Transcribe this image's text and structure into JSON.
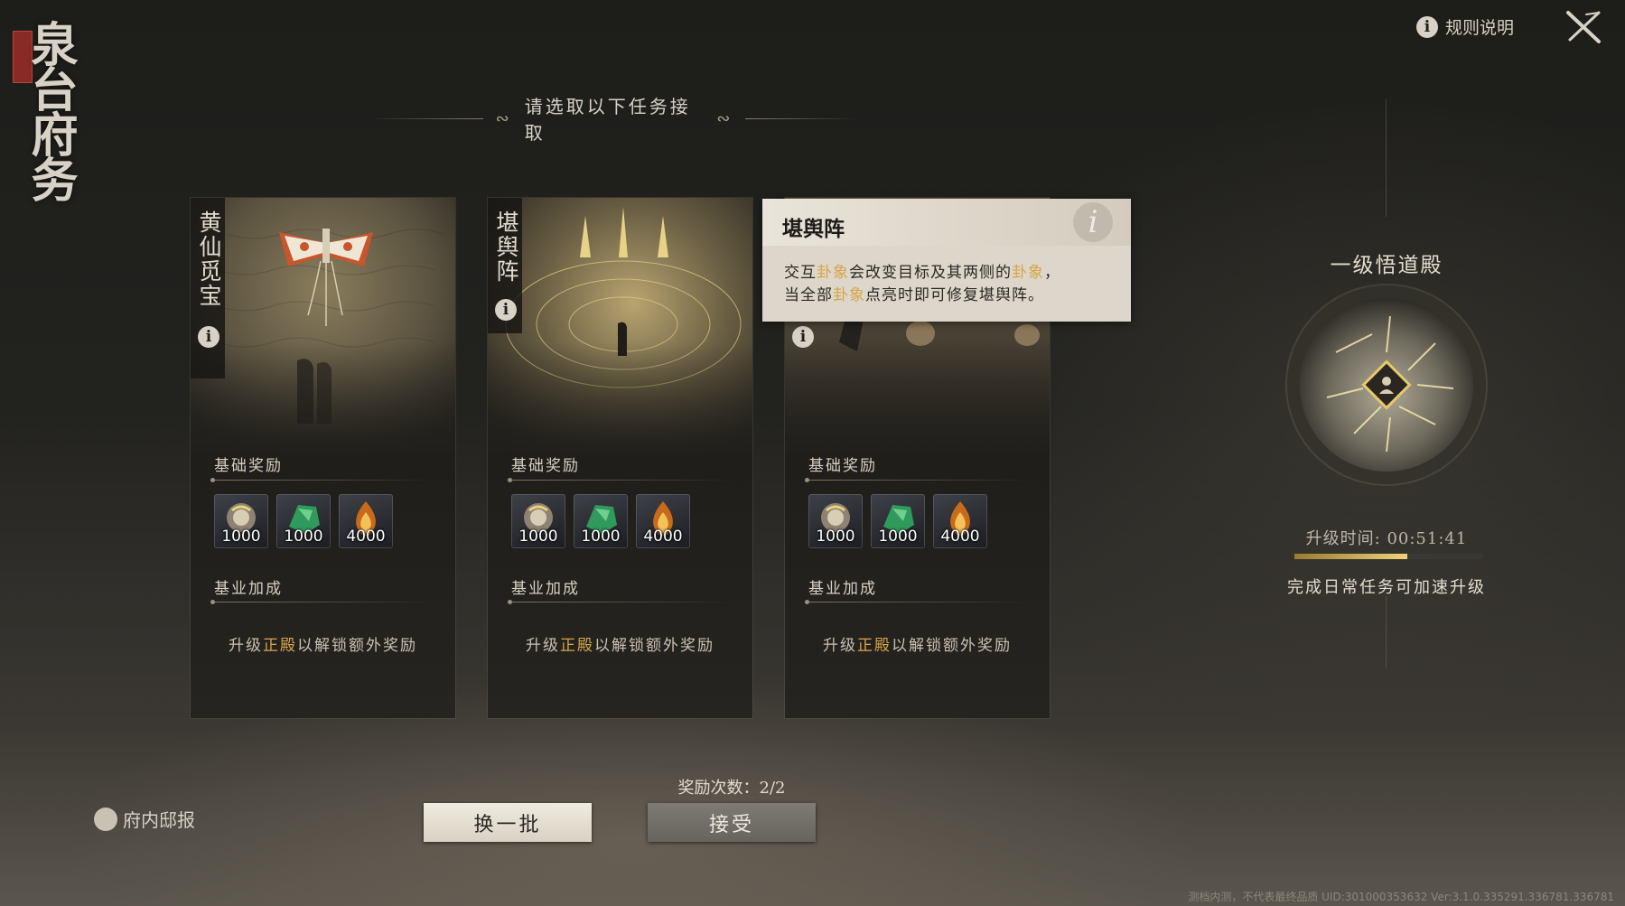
{
  "app": {
    "title": "泉台府务"
  },
  "header": {
    "rules_label": "规则说明",
    "info_glyph": "i",
    "close_icon": "close-x-icon"
  },
  "prompt": "请选取以下任务接取",
  "cards": [
    {
      "title": "黄仙觅宝",
      "base_reward_label": "基础奖励",
      "rewards": [
        "1000",
        "1000",
        "4000"
      ],
      "bonus_label": "基业加成",
      "unlock_pre": "升级",
      "unlock_hl": "正殿",
      "unlock_post": "以解锁额外奖励"
    },
    {
      "title": "堪舆阵",
      "base_reward_label": "基础奖励",
      "rewards": [
        "1000",
        "1000",
        "4000"
      ],
      "bonus_label": "基业加成",
      "unlock_pre": "升级",
      "unlock_hl": "正殿",
      "unlock_post": "以解锁额外奖励"
    },
    {
      "title": "",
      "base_reward_label": "基础奖励",
      "rewards": [
        "1000",
        "1000",
        "4000"
      ],
      "bonus_label": "基业加成",
      "unlock_pre": "升级",
      "unlock_hl": "正殿",
      "unlock_post": "以解锁额外奖励"
    }
  ],
  "reward_icons": [
    "coin-medallion-icon",
    "jade-stone-icon",
    "flame-icon"
  ],
  "tooltip": {
    "title": "堪舆阵",
    "line1_a": "交互",
    "line1_hl1": "卦象",
    "line1_b": "会改变目标及其两侧的",
    "line1_hl2": "卦象",
    "line1_c": "，",
    "line2_a": "当全部",
    "line2_hl": "卦象",
    "line2_b": "点亮时即可修复堪舆阵。"
  },
  "hall": {
    "title": "一级悟道殿",
    "upgrade_time": "升级时间: 00:51:41",
    "progress": 0.6,
    "hint": "完成日常任务可加速升级"
  },
  "bottom": {
    "mail_label": "府内邸报",
    "reward_count": "奖励次数：2/2",
    "swap_label": "换一批",
    "accept_label": "接受"
  },
  "footer": "测档内测，不代表最终品质 UID:301000353632 Ver:3.1.0.335291.336781.336781",
  "colors": {
    "highlight": "#d6a64a",
    "background": "#1d1d1a"
  }
}
